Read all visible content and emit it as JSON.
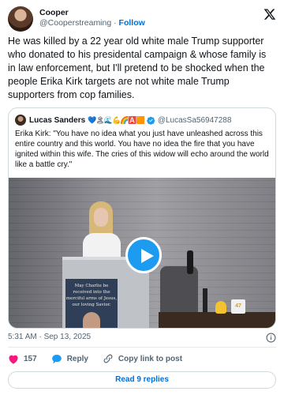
{
  "author": {
    "name": "Cooper",
    "handle": "@Cooperstreaming",
    "separator": "·",
    "follow_label": "Follow"
  },
  "tweet": {
    "text": "He was killed by a 22 year old white male Trump supporter who donated to his presidental campaign & whose family is in law enforcement, but I'll pretend to be shocked when the people Erika Kirk targets are not white male Trump supporters from cop families."
  },
  "quote": {
    "name": "Lucas Sanders",
    "emojis": "💙🏝🌊💪🌈🅰️🟧",
    "handle": "@LucasSa56947288",
    "text": "Erika Kirk: \"You have no idea what you just have unleashed across this entire country and this world. You have no idea the fire that you have ignited within this wife. The cries of this widow will echo around the world like a battle cry.\"",
    "media": {
      "poster_text": "May Charlie be received into the merciful arms of Jesus, our loving Savior.",
      "cup_text": "47"
    }
  },
  "meta": {
    "timestamp": "5:31 AM · Sep 13, 2025"
  },
  "actions": {
    "likes": "157",
    "reply_label": "Reply",
    "copy_label": "Copy link to post"
  },
  "replies_button": "Read 9 replies",
  "colors": {
    "link": "#006fd6",
    "like": "#f91880",
    "reply": "#1d9bf0",
    "play": "#1d9bf0"
  }
}
